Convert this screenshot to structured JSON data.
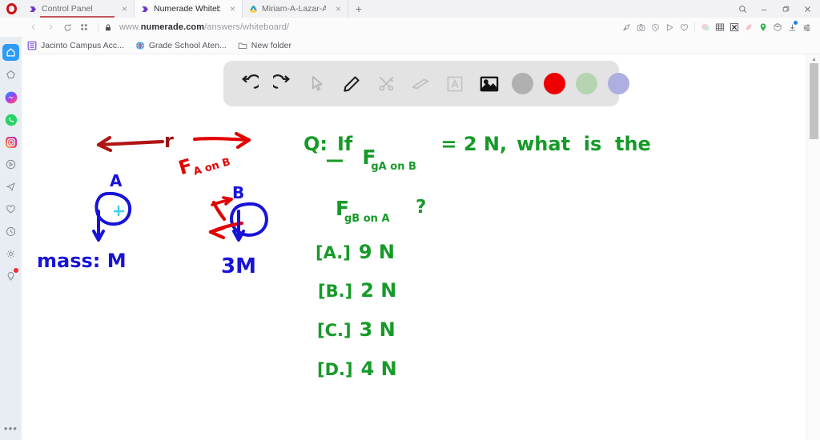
{
  "browser": {
    "app_logo": "opera-logo",
    "tabs": [
      {
        "title": "Control Panel",
        "favicon": "numerade-icon",
        "active": false,
        "close_label": "×"
      },
      {
        "title": "Numerade Whiteboard",
        "favicon": "numerade-icon",
        "active": true,
        "close_label": "×"
      },
      {
        "title": "Miriam-A-Lazar-Albert-Ta",
        "favicon": "google-drive-icon",
        "active": false,
        "close_label": "×"
      }
    ],
    "new_tab_label": "+",
    "window_controls": {
      "search": "⚲",
      "minimize": "–",
      "maximize": "❐",
      "close": "×"
    },
    "nav": {
      "back": "‹",
      "forward": "›",
      "reload": "⟳",
      "tiles": "∷"
    },
    "url": {
      "secure_icon": "lock-icon",
      "prefix": "www.",
      "domain": "numerade.com",
      "path": "/answers/whiteboard/"
    },
    "extension_icons": [
      "edit-page-icon",
      "snapshot-icon",
      "adblock-icon",
      "send-icon",
      "heart-icon",
      "color-bubble-icon",
      "grid-icon",
      "crypto-wallet-icon",
      "leaf-icon",
      "location-pin-icon",
      "cube-icon",
      "download-icon",
      "sliders-icon"
    ],
    "bookmarks": [
      {
        "label": "Jacinto Campus Acc...",
        "icon": "document-icon"
      },
      {
        "label": "Grade School Aten...",
        "icon": "globe-icon"
      },
      {
        "label": "New folder",
        "icon": "folder-icon"
      }
    ]
  },
  "sidebar": {
    "items": [
      {
        "name": "home",
        "icon": "home-icon",
        "active": true,
        "badge": false
      },
      {
        "name": "workspace",
        "icon": "pentagon-icon",
        "active": false,
        "badge": false
      },
      {
        "name": "messenger",
        "icon": "messenger-icon",
        "active": false,
        "badge": false
      },
      {
        "name": "whatsapp",
        "icon": "whatsapp-icon",
        "active": false,
        "badge": false
      },
      {
        "name": "instagram",
        "icon": "instagram-icon",
        "active": false,
        "badge": false
      },
      {
        "name": "player",
        "icon": "player-icon",
        "active": false,
        "badge": false
      },
      {
        "name": "telegram",
        "icon": "telegram-icon",
        "active": false,
        "badge": false
      },
      {
        "name": "favorites",
        "icon": "heart-icon",
        "active": false,
        "badge": false
      },
      {
        "name": "history",
        "icon": "clock-icon",
        "active": false,
        "badge": false
      },
      {
        "name": "settings",
        "icon": "gear-icon",
        "active": false,
        "badge": false
      },
      {
        "name": "tips",
        "icon": "lightbulb-icon",
        "active": false,
        "badge": true
      }
    ],
    "more_label": "•••"
  },
  "whiteboard": {
    "toolbar": {
      "tools": [
        {
          "name": "undo",
          "icon": "undo-icon",
          "state": "enabled"
        },
        {
          "name": "redo",
          "icon": "redo-icon",
          "state": "enabled"
        },
        {
          "name": "select",
          "icon": "cursor-icon",
          "state": "disabled"
        },
        {
          "name": "pen",
          "icon": "pencil-icon",
          "state": "enabled"
        },
        {
          "name": "shapes",
          "icon": "tools-icon",
          "state": "disabled"
        },
        {
          "name": "eraser",
          "icon": "eraser-icon",
          "state": "disabled"
        },
        {
          "name": "text",
          "icon": "text-a-icon",
          "state": "disabled"
        },
        {
          "name": "image",
          "icon": "image-icon",
          "state": "enabled"
        }
      ],
      "swatches": [
        {
          "name": "gray",
          "color": "#b0b0b0",
          "selected": false
        },
        {
          "name": "red",
          "color": "#ee0000",
          "selected": true
        },
        {
          "name": "green",
          "color": "#b5d5b0",
          "selected": false
        },
        {
          "name": "purple",
          "color": "#afaee0",
          "selected": false
        }
      ]
    },
    "scrollbar": {
      "up_arrow": "▲"
    },
    "colors": {
      "blue_ink": "#1713d8",
      "red_ink": "#e50000",
      "dark_red_ink": "#9e1111",
      "green_ink": "#169a28",
      "cyan_ink": "#3fd2e8"
    },
    "diagram": {
      "distance_label": "r",
      "body_a_label": "A",
      "body_b_label": "B",
      "force_label": "Fₐ ₒₙ ᵦ",
      "force_label_main": "F",
      "force_label_sub": "A on B",
      "mass_a_label": "mass: M",
      "mass_b_label": "3M"
    },
    "question": {
      "prefix": "Q:",
      "line1_a": "If",
      "force_given_main": "F",
      "force_given_sub": "gA on B",
      "equals": "= 2 N,",
      "line1_b": "what  is  the",
      "force_asked_main": "F",
      "force_asked_sub": "gB on A",
      "question_mark": "?",
      "choices": [
        {
          "tag": "[A.]",
          "value": "9 N"
        },
        {
          "tag": "[B.]",
          "value": "2 N"
        },
        {
          "tag": "[C.]",
          "value": "3 N"
        },
        {
          "tag": "[D.]",
          "value": "4 N"
        }
      ]
    }
  }
}
